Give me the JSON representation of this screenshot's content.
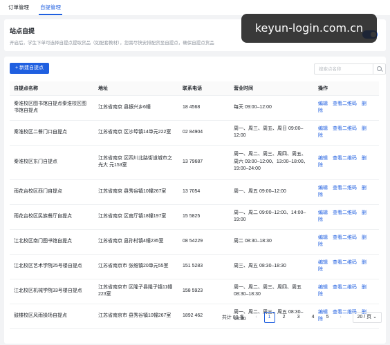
{
  "tabs": [
    {
      "label": "订单管理"
    },
    {
      "label": "自提管理"
    }
  ],
  "watermark": "keyun-login.com.cn",
  "settings": {
    "title": "站点自提",
    "description": "开启后，学生下单可选择自提点提取货品（如配套教材），您需尽快安排配货至自提点，确保自提点货品",
    "enabled": true
  },
  "toolbar": {
    "add_label": "+ 新建自提点",
    "search_placeholder": "搜索点名称"
  },
  "table": {
    "headers": [
      "自提点名称",
      "地址",
      "联系电话",
      "营业时间",
      "操作"
    ],
    "actions": [
      "编辑",
      "查看二维码",
      "删除"
    ],
    "rows": [
      {
        "name": "秦淮校区图书馆自提点秦淮校区图书馆自提点",
        "address": "江苏省南京 县振兴乡6幢",
        "phone": "18 4568",
        "hours": "每天 09:00–12:00"
      },
      {
        "name": "秦淮校区二餐门口自提点",
        "address": "江苏省南京 区沙埠镇14单元222室",
        "phone": "02 84904",
        "hours": "周一、周三、周五、周日 09:00–12:00"
      },
      {
        "name": "秦淮校区东门自提点",
        "address": "江苏省南京 区四川北路街道城市之光大 元153室",
        "phone": "13 79687",
        "hours": "周一、周二、周三、周四、周五、周六 09:00–12:00、13:00–18:00、19:00–24:00"
      },
      {
        "name": "雨花台校区西门自提点",
        "address": "江苏省南京 县秀谷镇10幢267室",
        "phone": "13 7054",
        "hours": "周一、周五 09:00–12:00"
      },
      {
        "name": "雨花台校区民族餐厅自提点",
        "address": "江苏省南京 区官厅镇18幢197室",
        "phone": "15 5825",
        "hours": "周一、周二 09:00–12:00、14:00–19:00"
      },
      {
        "name": "江北校区南门图书馆自提点",
        "address": "江苏省南京 县孙村镇4幢235室",
        "phone": "08 54229",
        "hours": "周二 08:30–18:30"
      },
      {
        "name": "江北校区艺术学院25号楼自提点",
        "address": "江苏省南京市 张维镇20单元55室",
        "phone": "151 5283",
        "hours": "周三、周五 08:30–18:30"
      },
      {
        "name": "江北校区机械学院33号楼自提点",
        "address": "江苏省南京市 区隆子县隆子镇11幢223室",
        "phone": "158 5923",
        "hours": "周一、周二、周三、周四、周五 08:30–18:30"
      },
      {
        "name": "鼓楼校区风雨操场自提点",
        "address": "江苏省南京市 县秀谷镇10幢267室",
        "phone": "1892 462",
        "hours": "周一、周二、周三、周五 08:30–18:30"
      }
    ]
  },
  "pagination": {
    "total_label": "共计 89 条",
    "pages": [
      "1",
      "2",
      "3",
      "4",
      "5"
    ],
    "current_page": "1",
    "page_size_label": "20 / 页"
  }
}
